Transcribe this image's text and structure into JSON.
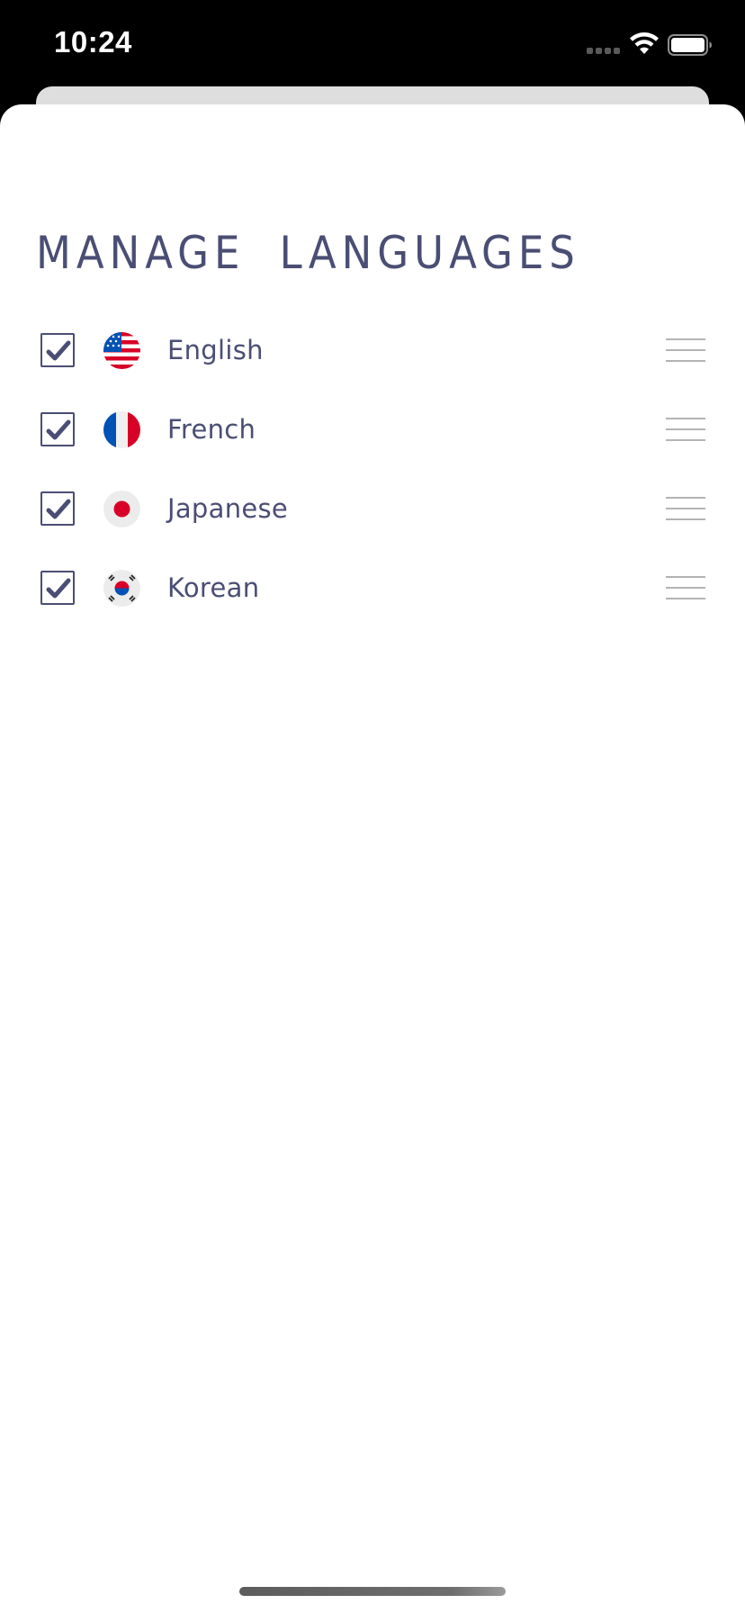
{
  "status_bar": {
    "time": "10:24",
    "icons": [
      "cellular-signal-icon",
      "wifi-icon",
      "battery-icon"
    ]
  },
  "sheet": {
    "title": "MANAGE  LANGUAGES"
  },
  "languages": [
    {
      "label": "English",
      "checked": true,
      "flag": "us-flag-icon"
    },
    {
      "label": "French",
      "checked": true,
      "flag": "france-flag-icon"
    },
    {
      "label": "Japanese",
      "checked": true,
      "flag": "japan-flag-icon"
    },
    {
      "label": "Korean",
      "checked": true,
      "flag": "korea-flag-icon"
    }
  ],
  "colors": {
    "accent": "#4a4e74",
    "drag_handle": "#b4b4b4",
    "background": "#ffffff",
    "status_bar": "#000000"
  }
}
